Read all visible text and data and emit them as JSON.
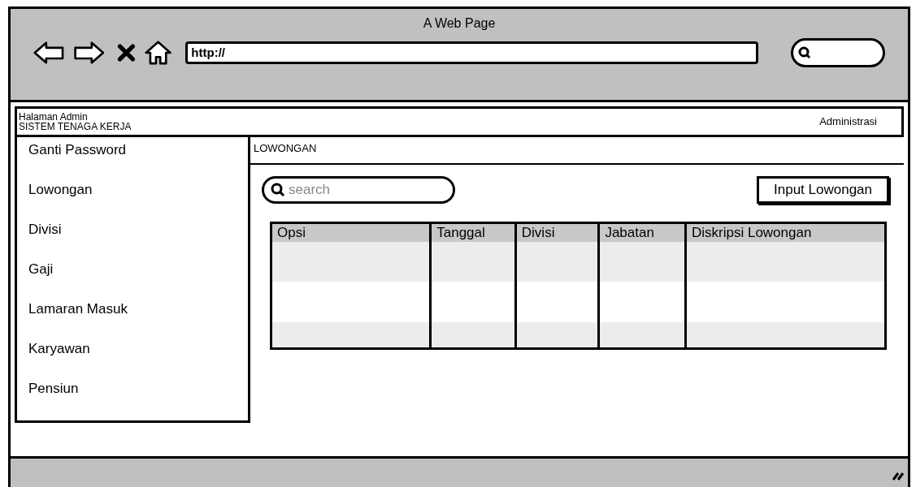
{
  "browser": {
    "title": "A Web Page",
    "url": "http://"
  },
  "header": {
    "subtitle": "Halaman Admin",
    "title": "SISTEM TENAGA KERJA",
    "user_menu": "Administrasi"
  },
  "sidebar": {
    "items": [
      {
        "label": "Ganti Password"
      },
      {
        "label": "Lowongan"
      },
      {
        "label": "Divisi"
      },
      {
        "label": "Gaji"
      },
      {
        "label": "Lamaran Masuk"
      },
      {
        "label": "Karyawan"
      },
      {
        "label": "Pensiun"
      }
    ]
  },
  "content": {
    "heading": "LOWONGAN",
    "search": {
      "placeholder": "search"
    },
    "button": "Input Lowongan",
    "table": {
      "columns": [
        "Opsi",
        "Tanggal",
        "Divisi",
        "Jabatan",
        "Diskripsi Lowongan"
      ]
    }
  }
}
